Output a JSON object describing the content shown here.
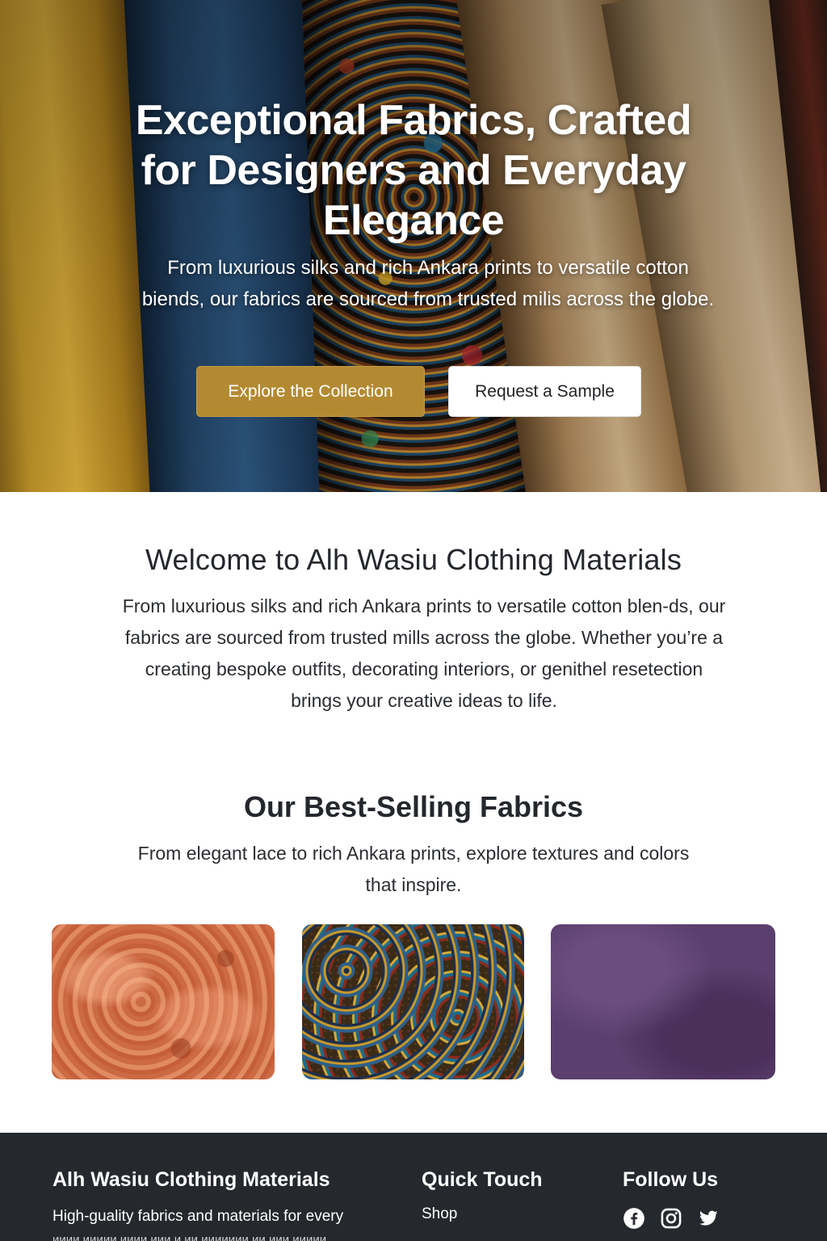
{
  "hero": {
    "title": "Exceptional Fabrics, Crafted for Designers and Everyday Elegance",
    "subtitle": "From luxurious silks and rich Ankara prints to versatile cotton biends, our fabrics are sourced from trusted milis across the globe.",
    "primary_button": "Explore the Collection",
    "secondary_button": "Request a Sample"
  },
  "welcome": {
    "title": "Welcome to Alh Wasiu Clothing Materials",
    "body": "From luxurious silks and rich Ankara prints to versatile cotton blen-ds, our fabrics are sourced from trusted mills across the globe. Whether you’re a creating bespoke outfits, decorating interiors, or genithel resetection brings your creative ideas to life."
  },
  "best_selling": {
    "title": "Our Best-Selling Fabrics",
    "subtitle": "From elegant lace to rich Ankara prints, explore textures and colors that inspire.",
    "cards": [
      {
        "icon": "coral-lace-fabric",
        "color": "#d27650"
      },
      {
        "icon": "ankara-print-fabric",
        "color": "#3a2a16"
      },
      {
        "icon": "purple-velvet-fabric",
        "color": "#5b3f6e"
      }
    ]
  },
  "footer": {
    "brand": "Alh Wasiu Clothing Materials",
    "description": "High-guality fabrics and materials for every",
    "description_cut": "ииии иииии ииии иии и ии иииииии ии иии иииии",
    "quick_title": "Quick Touch",
    "quick_links": [
      "Shop"
    ],
    "follow_title": "Follow Us",
    "social": [
      "facebook-icon",
      "instagram-icon",
      "twitter-icon"
    ]
  },
  "colors": {
    "accent": "#b38a32",
    "footer_bg": "#25282d",
    "text": "#22252a"
  }
}
